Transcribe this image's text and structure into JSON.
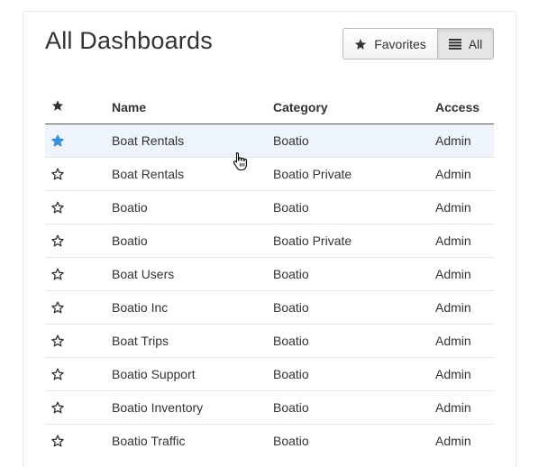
{
  "page": {
    "title": "All Dashboards"
  },
  "filter": {
    "favorites_label": "Favorites",
    "all_label": "All",
    "active": "All",
    "favorites_icon": "star-icon",
    "all_icon": "list-icon"
  },
  "table": {
    "columns": {
      "favorite_icon": "star-icon",
      "name": "Name",
      "category": "Category",
      "access": "Access"
    },
    "rows": [
      {
        "name": "Boat Rentals",
        "category": "Boatio",
        "access": "Admin",
        "favorite": true
      },
      {
        "name": "Boat Rentals",
        "category": "Boatio Private",
        "access": "Admin",
        "favorite": false
      },
      {
        "name": "Boatio",
        "category": "Boatio",
        "access": "Admin",
        "favorite": false
      },
      {
        "name": "Boatio",
        "category": "Boatio Private",
        "access": "Admin",
        "favorite": false
      },
      {
        "name": "Boat Users",
        "category": "Boatio",
        "access": "Admin",
        "favorite": false
      },
      {
        "name": "Boatio Inc",
        "category": "Boatio",
        "access": "Admin",
        "favorite": false
      },
      {
        "name": "Boat Trips",
        "category": "Boatio",
        "access": "Admin",
        "favorite": false
      },
      {
        "name": "Boatio Support",
        "category": "Boatio",
        "access": "Admin",
        "favorite": false
      },
      {
        "name": "Boatio Inventory",
        "category": "Boatio",
        "access": "Admin",
        "favorite": false
      },
      {
        "name": "Boatio Traffic",
        "category": "Boatio",
        "access": "Admin",
        "favorite": false
      }
    ]
  },
  "colors": {
    "favorite_star": "#3a8fd9",
    "row_hover": "#eef4fb"
  }
}
